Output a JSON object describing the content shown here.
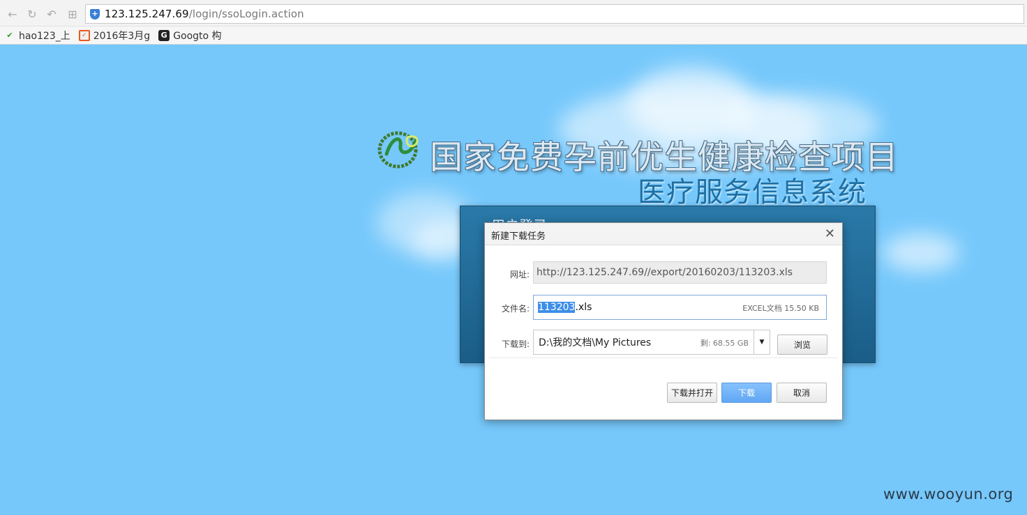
{
  "browser": {
    "url_host": "123.125.247.69",
    "url_path": "/login/ssoLogin.action",
    "bookmarks": [
      {
        "label": "hao123_上",
        "icon": "hao123-icon"
      },
      {
        "label": "2016年3月g",
        "icon": "calendar-icon"
      },
      {
        "label": "Googto 构",
        "icon": "googto-icon"
      }
    ]
  },
  "page": {
    "title_main": "国家免费孕前优生健康检查项目",
    "title_sub": "医疗服务信息系统",
    "login_title": "用户登录",
    "watermark": "www.wooyun.org"
  },
  "dialog": {
    "title": "新建下载任务",
    "url_label": "网址:",
    "url_value": "http://123.125.247.69//export/20160203/113203.xls",
    "filename_label": "文件名:",
    "filename_selected": "113203",
    "filename_ext": ".xls",
    "file_meta": "EXCEL文档  15.50 KB",
    "saveto_label": "下载到:",
    "save_path": "D:\\我的文档\\My Pictures",
    "free_space": "剩: 68.55 GB",
    "browse_label": "浏览",
    "download_open_label": "下载并打开",
    "download_label": "下载",
    "cancel_label": "取消"
  },
  "colors": {
    "page_bg": "#76c8fb",
    "primary_button": "#6aaef6",
    "login_panel": "#1f6a98"
  }
}
